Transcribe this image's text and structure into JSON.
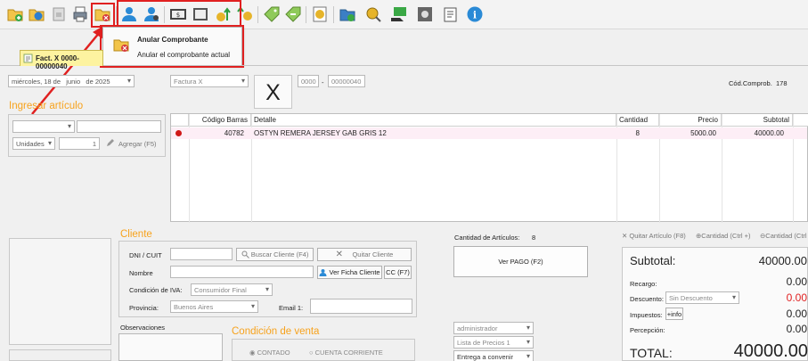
{
  "toolbar": {
    "icons": [
      "folder-add-icon",
      "folder-refresh-icon",
      "document-icon",
      "print-icon",
      "folder-cancel-icon",
      "user-icon",
      "users-icon",
      "register-icon",
      "calculator-icon",
      "money-up-icon",
      "money-icon",
      "tag-add-icon",
      "tag-remove-icon",
      "coin-icon",
      "folder-money-icon",
      "money-search-icon",
      "money-hand-icon",
      "settings-icon",
      "list-edit-icon",
      "info-icon"
    ]
  },
  "tooltip": {
    "title": "Anular Comprobante",
    "description": "Anular el comprobante actual"
  },
  "tab": {
    "label": "Fact. X 0000-00000040"
  },
  "header": {
    "date": {
      "day": "miércoles, 18 de",
      "month": "junio",
      "year": "de 2025"
    },
    "doc_type": "Factura X",
    "letter": "X",
    "point_of_sale": "0000",
    "number": "00000040",
    "number_sep": "-",
    "code_label": "Cód.Comprob.",
    "code_value": "178"
  },
  "ingresar": {
    "title": "Ingresar artículo",
    "unit": "Unidades",
    "quantity": "1",
    "add_label": "Agregar (F5)"
  },
  "grid": {
    "columns": [
      "Código Barras",
      "Detalle",
      "Cantidad",
      "Precio",
      "Subtotal"
    ],
    "rows": [
      {
        "codigo": "40782",
        "detalle": "OSTYN REMERA JERSEY GAB GRIS 12",
        "cantidad": "8",
        "precio": "5000.00",
        "subtotal": "40000.00"
      }
    ]
  },
  "cliente": {
    "title": "Cliente",
    "dni_label": "DNI / CUIT",
    "buscar_label": "Buscar Cliente (F4)",
    "quitar_label": "Quitar Cliente",
    "nombre_label": "Nombre",
    "ver_ficha_label": "Ver Ficha Cliente",
    "cc_label": "CC (F7)",
    "iva_label": "Condición de IVA:",
    "iva_value": "Consumidor Final",
    "provincia_label": "Provincia:",
    "provincia_value": "Buenos Aires",
    "email_label": "Email 1:"
  },
  "observaciones": {
    "label": "Observaciones"
  },
  "venta": {
    "title": "Condición de venta",
    "contado": "CONTADO",
    "cuenta": "CUENTA CORRIENTE"
  },
  "articulos": {
    "label": "Cantidad de Artículos:",
    "count": "8",
    "ver_pago": "Ver PAGO (F2)",
    "vendedor": "administrador",
    "lista": "Lista de Precios 1",
    "entrega": "Entrega a convenir"
  },
  "actions": {
    "quitar_articulo": "Quitar Artículo (F8)",
    "cantidad_mas": "Cantidad (Ctrl +)",
    "cantidad_menos": "Cantidad (Ctrl"
  },
  "totales": {
    "subtotal_label": "Subtotal:",
    "subtotal_value": "40000.00",
    "recargo_label": "Recargo:",
    "recargo_value": "0.00",
    "descuento_label": "Descuento:",
    "descuento_select": "Sin Descuento",
    "descuento_value": "0.00",
    "impuestos_label": "Impuestos:",
    "impuestos_btn": "+info",
    "impuestos_value": "0.00",
    "percepcion_label": "Percepción:",
    "percepcion_value": "0.00",
    "total_label": "TOTAL:",
    "total_value": "40000.00"
  },
  "colors": {
    "accent": "#f7a21c",
    "highlight_red": "#e02020",
    "tab_yellow": "#fdf3a0",
    "row_pink": "#fdeef6",
    "discount_red": "#e02020"
  }
}
